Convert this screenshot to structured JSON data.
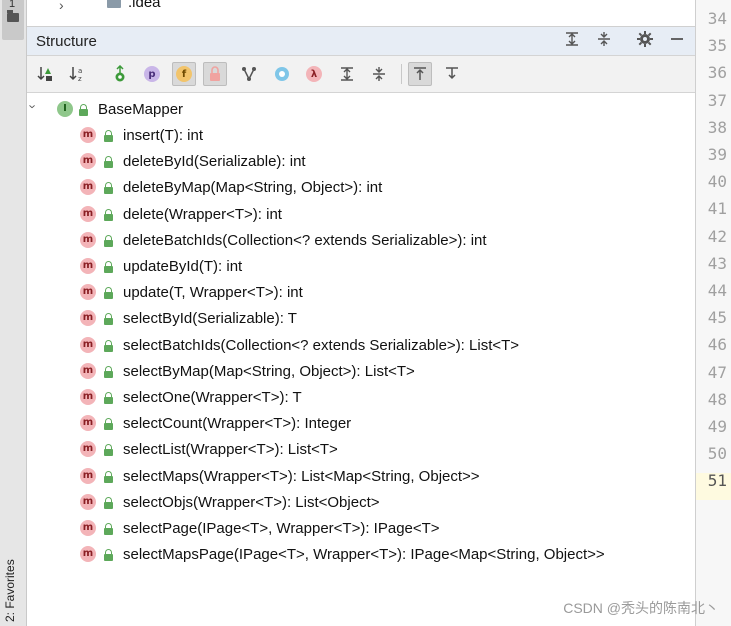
{
  "left_strip": {
    "project_tab_number": "1",
    "favorites_label": "2: Favorites"
  },
  "top_tree": {
    "folder_name": ".idea"
  },
  "panel": {
    "title": "Structure"
  },
  "toolbar": {
    "buttons": [
      {
        "name": "sort-by-visibility",
        "glyph": "↓⇅"
      },
      {
        "name": "sort-alphabetically",
        "glyph": "↓a"
      },
      {
        "name": "show-inherited",
        "glyph": "↑"
      },
      {
        "name": "show-properties",
        "glyph": "p"
      },
      {
        "name": "show-fields",
        "glyph": "f"
      },
      {
        "name": "show-non-public",
        "glyph": "🔒"
      },
      {
        "name": "group",
        "glyph": "Y"
      },
      {
        "name": "show-anonymous",
        "glyph": "●"
      },
      {
        "name": "show-lambdas",
        "glyph": "λ"
      },
      {
        "name": "expand-all",
        "glyph": "⇕"
      },
      {
        "name": "collapse-all",
        "glyph": "⇟"
      },
      {
        "name": "autoscroll-to-source",
        "glyph": "⤒"
      },
      {
        "name": "autoscroll-from-source",
        "glyph": "⤓"
      }
    ]
  },
  "tree": {
    "root": {
      "icon_letter": "I",
      "label": "BaseMapper"
    },
    "method_icon_letter": "m",
    "methods": [
      "insert(T): int",
      "deleteById(Serializable): int",
      "deleteByMap(Map<String, Object>): int",
      "delete(Wrapper<T>): int",
      "deleteBatchIds(Collection<? extends Serializable>): int",
      "updateById(T): int",
      "update(T, Wrapper<T>): int",
      "selectById(Serializable): T",
      "selectBatchIds(Collection<? extends Serializable>): List<T>",
      "selectByMap(Map<String, Object>): List<T>",
      "selectOne(Wrapper<T>): T",
      "selectCount(Wrapper<T>): Integer",
      "selectList(Wrapper<T>): List<T>",
      "selectMaps(Wrapper<T>): List<Map<String, Object>>",
      "selectObjs(Wrapper<T>): List<Object>",
      "selectPage(IPage<T>, Wrapper<T>): IPage<T>",
      "selectMapsPage(IPage<T>, Wrapper<T>): IPage<Map<String, Object>>"
    ]
  },
  "gutter": {
    "line_numbers": [
      "34",
      "35",
      "36",
      "37",
      "38",
      "39",
      "40",
      "41",
      "42",
      "43",
      "44",
      "45",
      "46",
      "47",
      "48",
      "49",
      "50",
      "51"
    ],
    "current_line": "51"
  },
  "watermark": "CSDN @秃头的陈南北丶"
}
